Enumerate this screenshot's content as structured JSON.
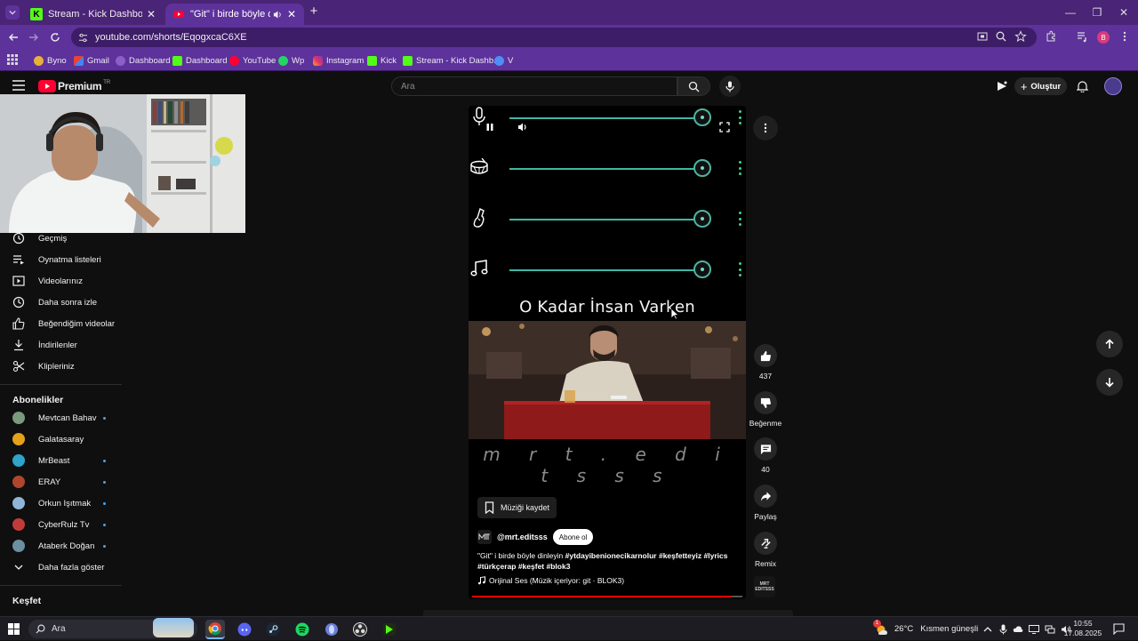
{
  "browser": {
    "tabs": [
      {
        "title": "Stream - Kick Dashboard",
        "active": false
      },
      {
        "title": "\"Git\" i birde böyle dinleyin",
        "active": true
      }
    ],
    "url": "youtube.com/shorts/EqogxcaC6XE",
    "bookmarks": [
      "Byno",
      "Gmail",
      "Dashboard",
      "Dashboard",
      "YouTube",
      "Wp",
      "Instagram",
      "Kick",
      "Stream - Kick Dashb...",
      "V"
    ]
  },
  "youtube": {
    "logo": "Premium",
    "region": "TR",
    "search_placeholder": "Ara",
    "create_label": "Oluştur"
  },
  "sidebar": {
    "you_items": [
      {
        "label": "Geçmiş",
        "icon": "history-icon"
      },
      {
        "label": "Oynatma listeleri",
        "icon": "playlist-icon"
      },
      {
        "label": "Videolarınız",
        "icon": "video-icon"
      },
      {
        "label": "Daha sonra izle",
        "icon": "clock-icon"
      },
      {
        "label": "Beğendiğim videolar",
        "icon": "thumb-up-icon"
      },
      {
        "label": "İndirilenler",
        "icon": "download-icon"
      },
      {
        "label": "Klipleriniz",
        "icon": "scissors-icon"
      }
    ],
    "subs_heading": "Abonelikler",
    "subscriptions": [
      {
        "name": "Mevtcan Bahav",
        "color": "#7a9a7e",
        "new": true
      },
      {
        "name": "Galatasaray",
        "color": "#e3a21a",
        "new": false
      },
      {
        "name": "MrBeast",
        "color": "#2fa3c9",
        "new": true
      },
      {
        "name": "ERAY",
        "color": "#b0452f",
        "new": true
      },
      {
        "name": "Orkun Işıtmak",
        "color": "#8fb6d8",
        "new": true
      },
      {
        "name": "CyberRulz Tv",
        "color": "#c23b3b",
        "new": true
      },
      {
        "name": "Ataberk Doğan",
        "color": "#6c8fa1",
        "new": true
      }
    ],
    "show_more": "Daha fazla göster",
    "explore_heading": "Keşfet"
  },
  "short": {
    "song_title": "O Kadar İnsan Varken",
    "watermark": "m r t . e d i t s s s",
    "save_music": "Müziği kaydet",
    "channel": "@mrt.editsss",
    "subscribe": "Abone ol",
    "desc_plain": "\"Git\" i birde böyle dinleyin ",
    "desc_tags_1": "#ytdayibenionecikarnolur #keşfetteyiz #lyrics",
    "desc_tags_2": "#türkçerap #keşfet #blok3",
    "audio": "Orijinal Ses (Müzik içeriyor: git · BLOK3)",
    "progress": 0.96,
    "like_count": "437",
    "dislike_label": "Beğenme",
    "comment_count": "40",
    "share_label": "Paylaş",
    "remix_label": "Remix",
    "channel_thumb_text": "MRT EDITSSS"
  },
  "taskbar": {
    "search": "Ara",
    "weather": "26°C",
    "weather_desc": "Kısmen güneşli",
    "time": "10:55",
    "date": "17.08.2025",
    "weather_badge": "1"
  },
  "colors": {
    "chrome_frame": "#4a2476",
    "chrome_toolbar": "#5d329a",
    "yt_bg": "#0f0f0f",
    "yt_red": "#ff0000",
    "track_teal": "#3fb7a4",
    "track_dots": "#3fd08d",
    "kick_green": "#53fc18"
  }
}
